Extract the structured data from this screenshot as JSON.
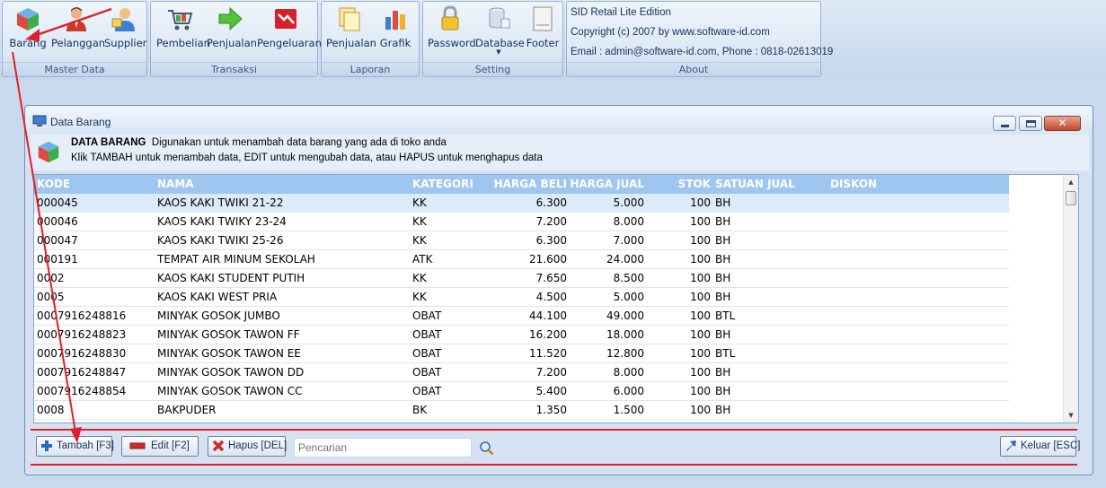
{
  "ribbon": {
    "master_data": {
      "label": "Master Data",
      "barang": "Barang",
      "pelanggan": "Pelanggan",
      "supplier": "Supplier"
    },
    "transaksi": {
      "label": "Transaksi",
      "pembelian": "Pembelian",
      "penjualan": "Penjualan",
      "pengeluaran": "Pengeluaran"
    },
    "laporan": {
      "label": "Laporan",
      "penjualan": "Penjualan",
      "grafik": "Grafik"
    },
    "setting": {
      "label": "Setting",
      "password": "Password",
      "database": "Database",
      "footer": "Footer"
    },
    "about": {
      "label": "About",
      "line1": "SID Retail Lite Edition",
      "line2": "Copyright (c) 2007 by www.software-id.com",
      "line3": "Email : admin@software-id.com, Phone : 0818-02613019"
    }
  },
  "window": {
    "title": "Data Barang",
    "header_title": "DATA BARANG",
    "header_desc": "Digunakan untuk menambah data barang yang ada di toko anda",
    "header_sub": "Klik TAMBAH untuk menambah data, EDIT untuk mengubah data, atau HAPUS untuk menghapus data"
  },
  "table": {
    "columns": [
      "KODE",
      "NAMA",
      "KATEGORI",
      "HARGA BELI",
      "HARGA JUAL",
      "STOK",
      "SATUAN JUAL",
      "DISKON"
    ],
    "rows": [
      [
        "000045",
        "KAOS KAKI TWIKI 21-22",
        "KK",
        "6.300",
        "5.000",
        "100",
        "BH",
        ""
      ],
      [
        "000046",
        "KAOS KAKI TWIKY 23-24",
        "KK",
        "7.200",
        "8.000",
        "100",
        "BH",
        ""
      ],
      [
        "000047",
        "KAOS KAKI TWIKI 25-26",
        "KK",
        "6.300",
        "7.000",
        "100",
        "BH",
        ""
      ],
      [
        "000191",
        "TEMPAT AIR MINUM SEKOLAH",
        "ATK",
        "21.600",
        "24.000",
        "100",
        "BH",
        ""
      ],
      [
        "0002",
        "KAOS KAKI STUDENT PUTIH",
        "KK",
        "7.650",
        "8.500",
        "100",
        "BH",
        ""
      ],
      [
        "0005",
        "KAOS KAKI WEST PRIA",
        "KK",
        "4.500",
        "5.000",
        "100",
        "BH",
        ""
      ],
      [
        "0007916248816",
        "MINYAK GOSOK JUMBO",
        "OBAT",
        "44.100",
        "49.000",
        "100",
        "BTL",
        ""
      ],
      [
        "0007916248823",
        "MINYAK GOSOK TAWON FF",
        "OBAT",
        "16.200",
        "18.000",
        "100",
        "BH",
        ""
      ],
      [
        "0007916248830",
        "MINYAK GOSOK TAWON EE",
        "OBAT",
        "11.520",
        "12.800",
        "100",
        "BTL",
        ""
      ],
      [
        "0007916248847",
        "MINYAK GOSOK TAWON DD",
        "OBAT",
        "7.200",
        "8.000",
        "100",
        "BH",
        ""
      ],
      [
        "0007916248854",
        "MINYAK GOSOK TAWON CC",
        "OBAT",
        "5.400",
        "6.000",
        "100",
        "BH",
        ""
      ],
      [
        "0008",
        "BAKPUDER",
        "BK",
        "1.350",
        "1.500",
        "100",
        "BH",
        ""
      ]
    ]
  },
  "toolbar": {
    "tambah": "Tambah [F3]",
    "edit": "Edit [F2]",
    "hapus": "Hapus [DEL]",
    "search_placeholder": "Pencarian",
    "keluar": "Keluar [ESC]"
  },
  "colors": {
    "header": "#9fc6f0",
    "annotation": "#e0202a",
    "selected_row": "#dcebf9"
  }
}
